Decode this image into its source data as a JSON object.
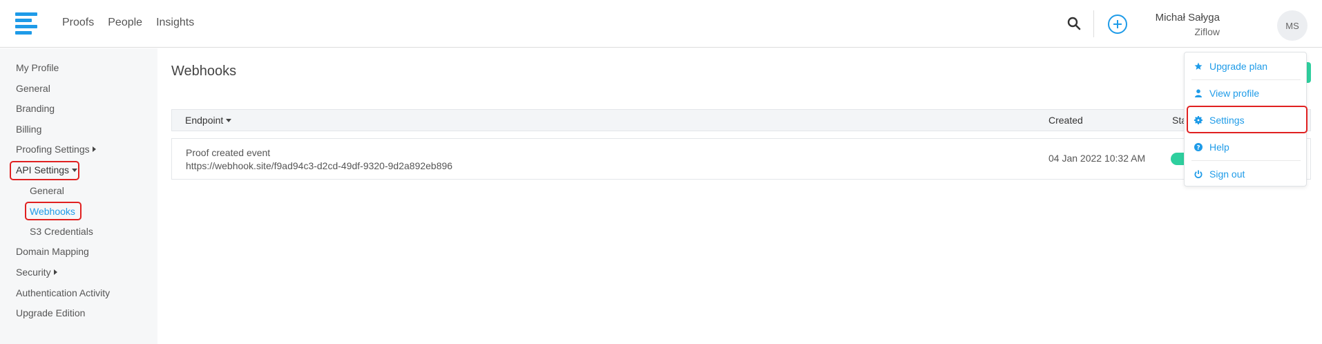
{
  "header": {
    "nav": [
      "Proofs",
      "People",
      "Insights"
    ],
    "user_name": "Michał Sałyga",
    "user_org": "Ziflow",
    "avatar_initials": "MS",
    "brand_color": "#1e9be8"
  },
  "sidebar": {
    "items": [
      {
        "label": "My Profile"
      },
      {
        "label": "General"
      },
      {
        "label": "Branding"
      },
      {
        "label": "Billing"
      },
      {
        "label": "Proofing Settings"
      },
      {
        "label": "API Settings"
      },
      {
        "label": "General"
      },
      {
        "label": "Webhooks"
      },
      {
        "label": "S3 Credentials"
      },
      {
        "label": "Domain Mapping"
      },
      {
        "label": "Security"
      },
      {
        "label": "Authentication Activity"
      },
      {
        "label": "Upgrade Edition"
      }
    ]
  },
  "main": {
    "title": "Webhooks",
    "columns": {
      "endpoint": "Endpoint",
      "created": "Created",
      "status": "Sta"
    },
    "rows": [
      {
        "event": "Proof created event",
        "url": "https://webhook.site/f9ad94c3-d2cd-49df-9320-9d2a892eb896",
        "created": "04 Jan 2022 10:32 AM"
      }
    ]
  },
  "dropdown": {
    "items": [
      {
        "label": "Upgrade plan",
        "icon": "star-icon"
      },
      {
        "label": "View profile",
        "icon": "user-icon"
      },
      {
        "label": "Settings",
        "icon": "gear-icon"
      },
      {
        "label": "Help",
        "icon": "question-icon"
      },
      {
        "label": "Sign out",
        "icon": "power-icon"
      }
    ]
  }
}
